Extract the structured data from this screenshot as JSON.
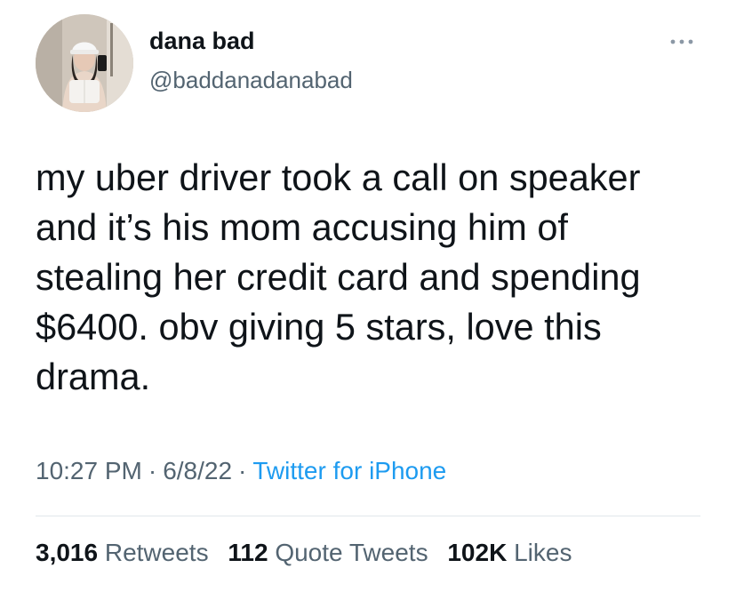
{
  "tweet": {
    "author": {
      "display_name": "dana bad",
      "handle": "@baddanadanabad",
      "avatar_icon": "profile-photo"
    },
    "more_icon": "more-horizontal-icon",
    "text": "my uber driver took a call on speaker\nand it’s his mom accusing him of\nstealing her credit card and spending\n$6400. obv giving 5 stars, love this\ndrama.",
    "time": "10:27 PM",
    "date": "6/8/22",
    "separator": "·",
    "source": "Twitter for iPhone",
    "stats": {
      "retweets_count": "3,016",
      "retweets_label": "Retweets",
      "quotes_count": "112",
      "quotes_label": "Quote Tweets",
      "likes_count": "102K",
      "likes_label": "Likes"
    }
  },
  "colors": {
    "text_primary": "#0f1419",
    "text_secondary": "#536471",
    "link": "#1d9bf0",
    "divider": "#e1e6ea"
  }
}
